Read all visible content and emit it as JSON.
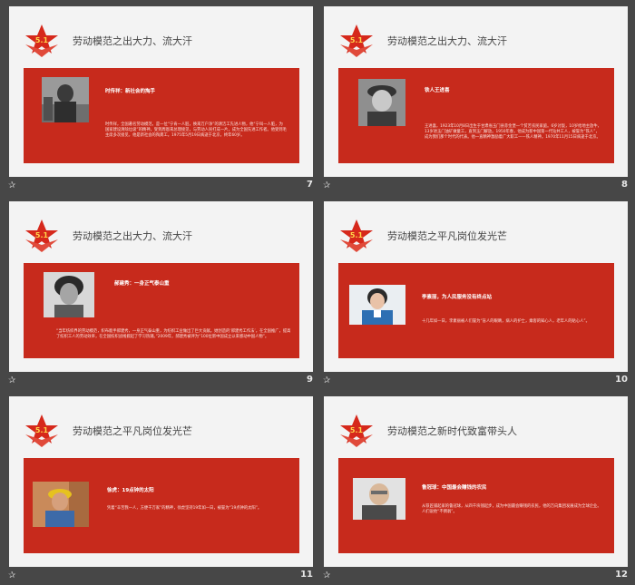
{
  "slides": [
    {
      "number": "7",
      "title": "劳动模范之出大力、流大汗",
      "name": "时传祥：新社会的掏手",
      "body": "时传祥，全国著名劳动模范。是一位“宁肯一人脏，换来万户净”的清洁工先进人物，他“宁叫一人脏，为国家建设清除垃圾”的精神，受到周恩来总理接见，与劳动人民打成一片，成为全国先进工作者。他受到毛主席多次接见，他是新社会的掏粪工。1975年5月19日病逝于北京，终年60岁。"
    },
    {
      "number": "8",
      "title": "劳动模范之出大力、流大汗",
      "name": "铁人王进喜",
      "body": "王进喜，1923年10月8日出生于甘肃省玉门县赤金堡一个贫苦农民家庭。6岁讨饭，10岁给地主放牛，13岁进玉门油矿做童工，直到玉门解放。1950年春，他成为新中国第一代钻井工人，被誉为“铁人”，成为我们那个时代的代表。他一直精神激励着广大职工——铁人精神。1970年11月15日病逝于北京。"
    },
    {
      "number": "9",
      "title": "劳动模范之出大力、流大汗",
      "name": "郝建秀：一身正气泰山重",
      "body": "“当年纺织界的劳动模范，织布能手郝建秀，一身正气泰山重，为纺织工业做出了巨大贡献。她创造的‘郝建秀工作法’，在全国推广，提高了纺织工人的劳动效率，在全国纺织战线掀起了学习热潮。”2009年，郝建秀被评为“100位新中国成立以来感动中国人物”。"
    },
    {
      "number": "10",
      "title": "劳动模范之平凡岗位发光芒",
      "name": "李素丽，为人民服务没有终点站",
      "body": "十几年如一日，李素丽被人们誉为“盲人的眼睛，病人的护士，乘客的知心人，老年人的贴心人”。"
    },
    {
      "number": "11",
      "title": "劳动模范之平凡岗位发光芒",
      "name": "徐虎：19点钟的太阳",
      "body": "凭着“辛苦我一人，方便千万家”的精神，徐虎坚持19年如一日，被誉为“19点钟的太阳”。"
    },
    {
      "number": "12",
      "title": "劳动模范之新时代致富带头人",
      "name": "鲁冠球：中国最会赚钱的农民",
      "body": "从铁匠铺起家的鲁冠球，从四千块钱起步，成为中国最会赚钱的农民，他的万向集团发展成为全球企业。人们说他“不倒翁”。"
    }
  ],
  "colors": {
    "band": "#c72a1c",
    "slide_bg": "#f3f3f3",
    "background": "#474747",
    "title_text": "#444444"
  },
  "icons": [
    "star-logo-icon",
    "slide-transition-icon"
  ]
}
